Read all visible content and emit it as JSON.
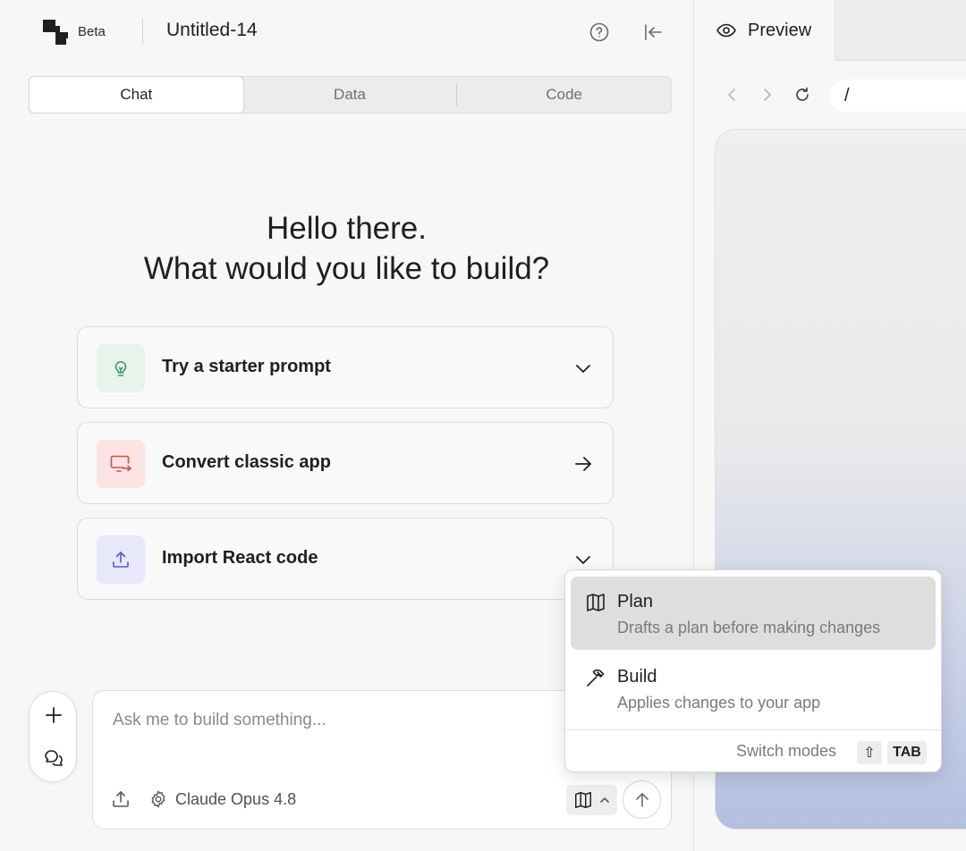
{
  "app": {
    "badge": "Beta",
    "doc_title": "Untitled-14"
  },
  "tabs": [
    {
      "label": "Chat",
      "active": true
    },
    {
      "label": "Data",
      "active": false
    },
    {
      "label": "Code",
      "active": false
    }
  ],
  "greeting": {
    "line1": "Hello there.",
    "line2": "What would you like to build?"
  },
  "cards": [
    {
      "label": "Try a starter prompt",
      "icon": "lightbulb-icon",
      "action": "chevron-down-icon",
      "accent": "#e8f3ec",
      "icon_color": "#3d9a5f"
    },
    {
      "label": "Convert classic app",
      "icon": "monitor-arrow-icon",
      "action": "arrow-right-icon",
      "accent": "#fbe3e3",
      "icon_color": "#d84a4a"
    },
    {
      "label": "Import React code",
      "icon": "upload-icon",
      "action": "chevron-down-icon",
      "accent": "#e8e8fb",
      "icon_color": "#5b53d6"
    }
  ],
  "composer": {
    "placeholder": "Ask me to build something...",
    "model": "Claude Opus 4.8"
  },
  "preview": {
    "tab_label": "Preview",
    "url": "/"
  },
  "mode_menu": {
    "items": [
      {
        "title": "Plan",
        "desc": "Drafts a plan before making changes",
        "icon": "map-icon",
        "selected": true
      },
      {
        "title": "Build",
        "desc": "Applies changes to your app",
        "icon": "hammer-icon",
        "selected": false
      }
    ],
    "switch_label": "Switch modes",
    "shift_key": "⇧",
    "tab_key": "TAB"
  }
}
